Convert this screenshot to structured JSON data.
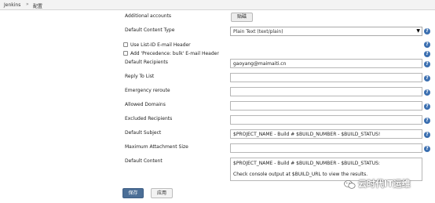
{
  "breadcrumb": {
    "home": "Jenkins",
    "separator": "»",
    "current": "配置"
  },
  "form": {
    "additional_accounts": {
      "label": "Additional accounts",
      "button": "贴磁"
    },
    "content_type": {
      "label": "Default Content Type",
      "value": "Plain Text (text/plain)"
    },
    "list_id_header": {
      "label": "Use List-ID E-mail Header",
      "checked": false
    },
    "precedence_header": {
      "label": "Add 'Precedence: bulk' E-mail Header",
      "checked": false
    },
    "recipients": {
      "label": "Default Recipients",
      "value": "gaoyang@maimaiti.cn"
    },
    "reply_to": {
      "label": "Reply To List",
      "value": ""
    },
    "emergency_reroute": {
      "label": "Emergency reroute",
      "value": ""
    },
    "allowed_domains": {
      "label": "Allowed Domains",
      "value": ""
    },
    "excluded_recipients": {
      "label": "Excluded Recipients",
      "value": ""
    },
    "subject": {
      "label": "Default Subject",
      "value": "$PROJECT_NAME - Build # $BUILD_NUMBER - $BUILD_STATUS!"
    },
    "max_attachment": {
      "label": "Maximum Attachment Size",
      "value": ""
    },
    "content": {
      "label": "Default Content",
      "lines": [
        "$PROJECT_NAME - Build # $BUILD_NUMBER - $BUILD_STATUS:",
        "",
        "Check console output at $BUILD_URL to view the results."
      ]
    }
  },
  "buttons": {
    "save": "保存",
    "apply": "应用"
  },
  "help_glyph": "?",
  "watermark": "云时代IT运维",
  "colors": {
    "primary_button": "#4b6e96",
    "help_icon": "#3b6fb0"
  }
}
